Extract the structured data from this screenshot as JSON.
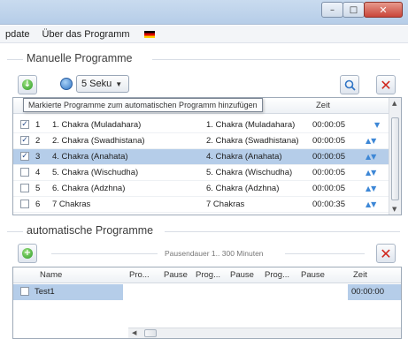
{
  "window": {
    "minimize": "–",
    "maximize": "□",
    "close": "✕"
  },
  "menu": {
    "items": [
      "pdate",
      "Über das Programm"
    ],
    "flag": "german-flag"
  },
  "manual": {
    "title": "Manuelle Programme",
    "interval_value": "5 Seku",
    "tooltip": "Markierte Programme zum automatischen Programm hinzufügen",
    "columns": [
      "Zeit"
    ],
    "rows": [
      {
        "n": "1",
        "name": "1. Chakra (Muladahara)",
        "chakra": "1. Chakra (Muladahara)",
        "time": "00:00:05",
        "checked": true,
        "selected": false,
        "arrows": "▼"
      },
      {
        "n": "2",
        "name": "2. Chakra (Swadhistana)",
        "chakra": "2. Chakra (Swadhistana)",
        "time": "00:00:05",
        "checked": true,
        "selected": false,
        "arrows": "▲▼"
      },
      {
        "n": "3",
        "name": "4. Chakra (Anahata)",
        "chakra": "4. Chakra (Anahata)",
        "time": "00:00:05",
        "checked": true,
        "selected": true,
        "arrows": "▲▼"
      },
      {
        "n": "4",
        "name": "5. Chakra (Wischudha)",
        "chakra": "5. Chakra (Wischudha)",
        "time": "00:00:05",
        "checked": false,
        "selected": false,
        "arrows": "▲▼"
      },
      {
        "n": "5",
        "name": "6. Chakra (Adzhna)",
        "chakra": "6. Chakra (Adzhna)",
        "time": "00:00:05",
        "checked": false,
        "selected": false,
        "arrows": "▲▼"
      },
      {
        "n": "6",
        "name": "7 Chakras",
        "chakra": "7 Chakras",
        "time": "00:00:35",
        "checked": false,
        "selected": false,
        "arrows": "▲▼"
      }
    ]
  },
  "auto": {
    "title": "automatische Programme",
    "pause_label": "Pausendauer 1.. 300 Minuten",
    "columns": [
      "Name",
      "Pro...",
      "Pause",
      "Prog...",
      "Pause",
      "Prog...",
      "Pause",
      "Zeit"
    ],
    "rows": [
      {
        "name": "Test1",
        "time": "00:00:00"
      }
    ]
  },
  "colors": {
    "selection": "#b5cde9",
    "accent_blue": "#3d87d6",
    "delete_red": "#d0261d"
  }
}
